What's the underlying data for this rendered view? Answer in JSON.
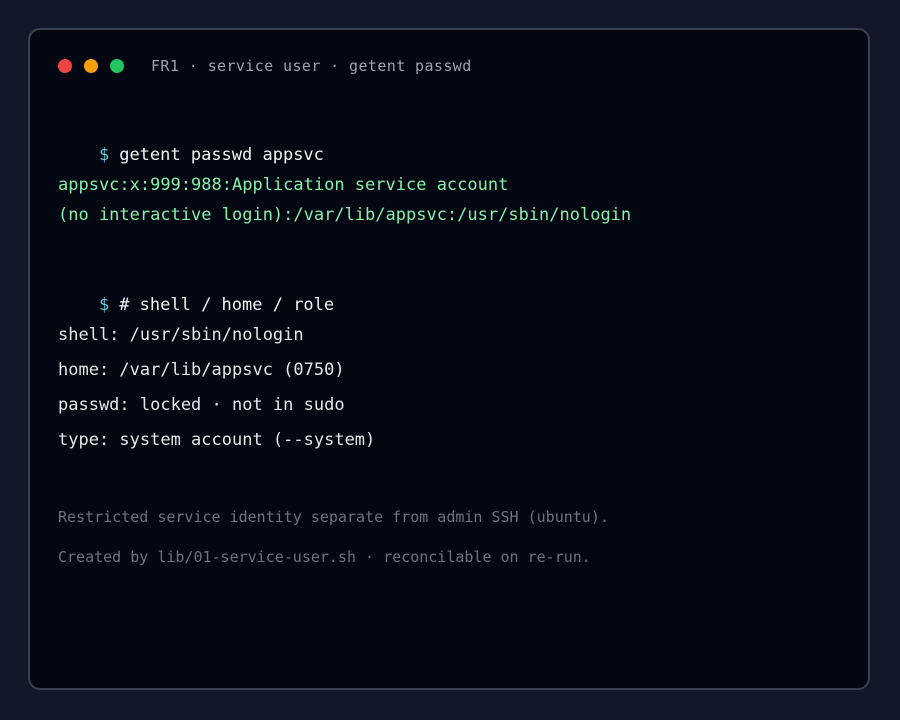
{
  "window": {
    "title": "FR1 · service user · getent passwd",
    "colors": {
      "background": "#030712",
      "border": "#374151",
      "prompt": "#67c7d3",
      "output": "#86efac",
      "note": "#6b7280"
    }
  },
  "terminal": {
    "prompt_symbol": "$",
    "command1": "getent passwd appsvc",
    "output1_line1": "appsvc:x:999:988:Application service account",
    "output1_line2": "(no interactive login):/var/lib/appsvc:/usr/sbin/nologin",
    "command2": "# shell / home / role",
    "details": [
      "shell: /usr/sbin/nologin",
      "home: /var/lib/appsvc (0750)",
      "passwd: locked · not in sudo",
      "type: system account (--system)"
    ],
    "notes": [
      "Restricted service identity separate from admin SSH (ubuntu).",
      "Created by lib/01-service-user.sh · reconcilable on re-run."
    ]
  }
}
